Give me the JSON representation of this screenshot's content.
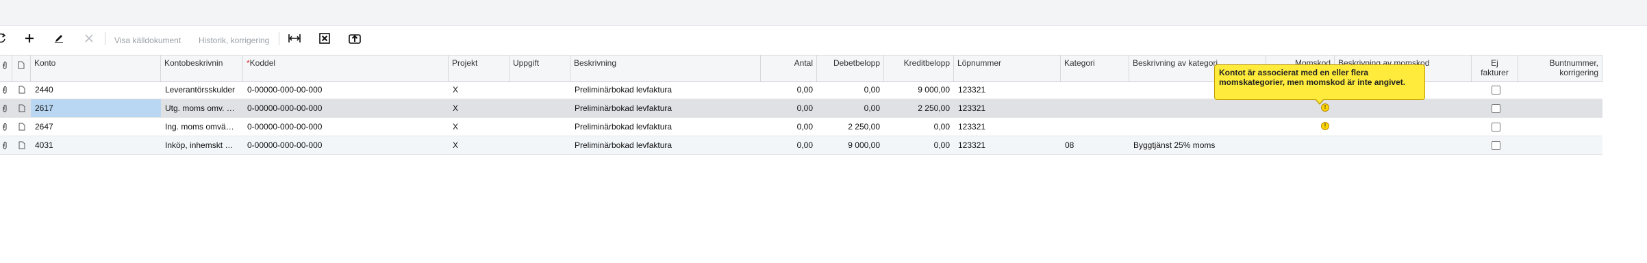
{
  "toolbar": {
    "buttons": [
      {
        "icon": "refresh-icon"
      },
      {
        "icon": "add-icon"
      },
      {
        "icon": "edit-icon"
      },
      {
        "icon": "delete-icon"
      }
    ],
    "show_source_label": "Visa källdokument",
    "history_label": "Historik, korrigering"
  },
  "grid": {
    "headers": {
      "konto": "Konto",
      "kontobeskrivning": "Kontobeskrivnin",
      "koddel_req": "*",
      "koddel": "Koddel",
      "projekt": "Projekt",
      "uppgift": "Uppgift",
      "beskrivning": "Beskrivning",
      "antal": "Antal",
      "debet": "Debetbelopp",
      "kredit": "Kreditbelopp",
      "lopnummer": "Löpnummer",
      "kategori": "Kategori",
      "besk_kategori": "Beskrivning av kategori",
      "momskod": "Momskod",
      "besk_momskod": "Beskrivning av momskod",
      "ej_fakt_1": "Ej",
      "ej_fakt_2": "fakturer",
      "bunt_1": "Buntnummer,",
      "bunt_2": "korrigering"
    },
    "rows": [
      {
        "konto": "2440",
        "kontobeskrivning": "Leverantörsskulder",
        "koddel": "0-00000-000-00-000",
        "projekt": "X",
        "uppgift": "",
        "beskrivning": "Preliminärbokad levfaktura",
        "antal": "0,00",
        "debet": "0,00",
        "kredit": "9 000,00",
        "lopnummer": "123321",
        "kategori": "",
        "besk_kategori": "",
        "selected": false
      },
      {
        "konto": "2617",
        "kontobeskrivning": "Utg. moms omv. …",
        "koddel": "0-00000-000-00-000",
        "projekt": "X",
        "uppgift": "",
        "beskrivning": "Preliminärbokad levfaktura",
        "antal": "0,00",
        "debet": "0,00",
        "kredit": "2 250,00",
        "lopnummer": "123321",
        "kategori": "",
        "besk_kategori": "",
        "selected": true
      },
      {
        "konto": "2647",
        "kontobeskrivning": "Ing. moms omvä…",
        "koddel": "0-00000-000-00-000",
        "projekt": "X",
        "uppgift": "",
        "beskrivning": "Preliminärbokad levfaktura",
        "antal": "0,00",
        "debet": "2 250,00",
        "kredit": "0,00",
        "lopnummer": "123321",
        "kategori": "",
        "besk_kategori": "",
        "selected": false
      },
      {
        "konto": "4031",
        "kontobeskrivning": "Inköp, inhemskt …",
        "koddel": "0-00000-000-00-000",
        "projekt": "X",
        "uppgift": "",
        "beskrivning": "Preliminärbokad levfaktura",
        "antal": "0,00",
        "debet": "9 000,00",
        "kredit": "0,00",
        "lopnummer": "123321",
        "kategori": "08",
        "besk_kategori": "Byggtjänst 25% moms",
        "selected": false
      }
    ]
  },
  "tooltip": {
    "text": "Kontot är associerat med en eller flera momskategorier, men momskod är inte angivet.",
    "warning_glyph": "!"
  },
  "colors": {
    "selected_row": "#dfe1e5",
    "selected_cell": "#b9d7f2",
    "tooltip_bg": "#ffeb3b",
    "required": "#d32f2f"
  }
}
